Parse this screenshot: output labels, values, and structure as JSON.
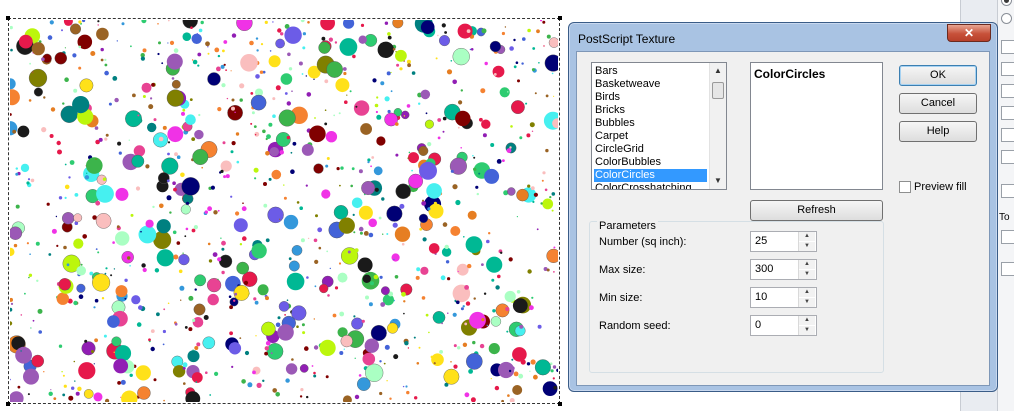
{
  "dialog": {
    "title": "PostScript Texture",
    "close_glyph": "✕",
    "textures": [
      "Bars",
      "Basketweave",
      "Birds",
      "Bricks",
      "Bubbles",
      "Carpet",
      "CircleGrid",
      "ColorBubbles",
      "ColorCircles",
      "ColorCrosshatching"
    ],
    "selected_index": 8,
    "selected_name": "ColorCircles",
    "buttons": {
      "ok": "OK",
      "cancel": "Cancel",
      "help": "Help",
      "refresh": "Refresh"
    },
    "preview_fill": {
      "label": "Preview fill",
      "checked": false
    },
    "parameters": {
      "title": "Parameters",
      "fields": [
        {
          "label": "Number (sq inch):",
          "value": "25"
        },
        {
          "label": "Max size:",
          "value": "300"
        },
        {
          "label": "Min size:",
          "value": "10"
        },
        {
          "label": "Random seed:",
          "value": "0"
        }
      ]
    }
  },
  "background_strip": {
    "text": "To"
  },
  "circle_palette": [
    "#e6194b",
    "#3cb44b",
    "#ffe119",
    "#4363d8",
    "#f58231",
    "#911eb4",
    "#46f0f0",
    "#f032e6",
    "#bcf60c",
    "#fabebe",
    "#008080",
    "#9a6324",
    "#800000",
    "#aaffc3",
    "#808000",
    "#000075",
    "#1a1a1a",
    "#2ecc71",
    "#3498db",
    "#9b59b6",
    "#e67e22",
    "#e84393",
    "#00b894",
    "#6c5ce7"
  ]
}
